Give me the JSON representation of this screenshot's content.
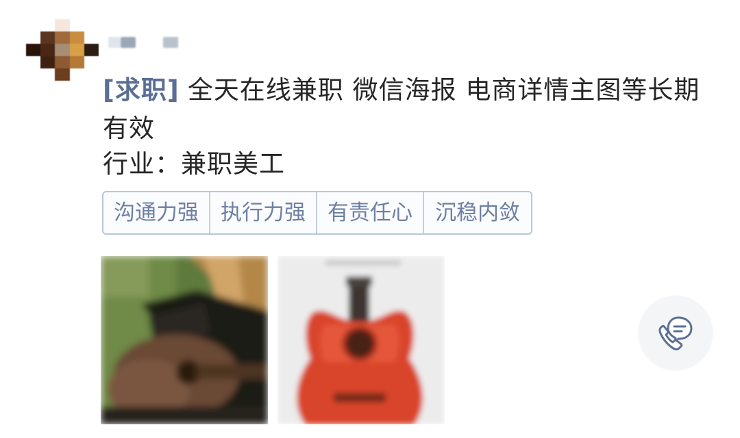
{
  "post": {
    "type_tag": "[求职]",
    "title": "全天在线兼职 微信海报 电商详情主图等长期有效",
    "industry": "行业：兼职美工"
  },
  "skills": [
    "沟通力强",
    "执行力强",
    "有责任心",
    "沉稳内敛"
  ],
  "photos": [
    {
      "icon": "guitar-photo-brown"
    },
    {
      "icon": "guitar-photo-red"
    }
  ],
  "actions": {
    "call_icon": "phone-chat-icon"
  },
  "colors": {
    "tag_accent": "#5a6f96",
    "skill_text": "#6d7fa3",
    "skill_border": "#b9c5db",
    "text": "#262626"
  }
}
